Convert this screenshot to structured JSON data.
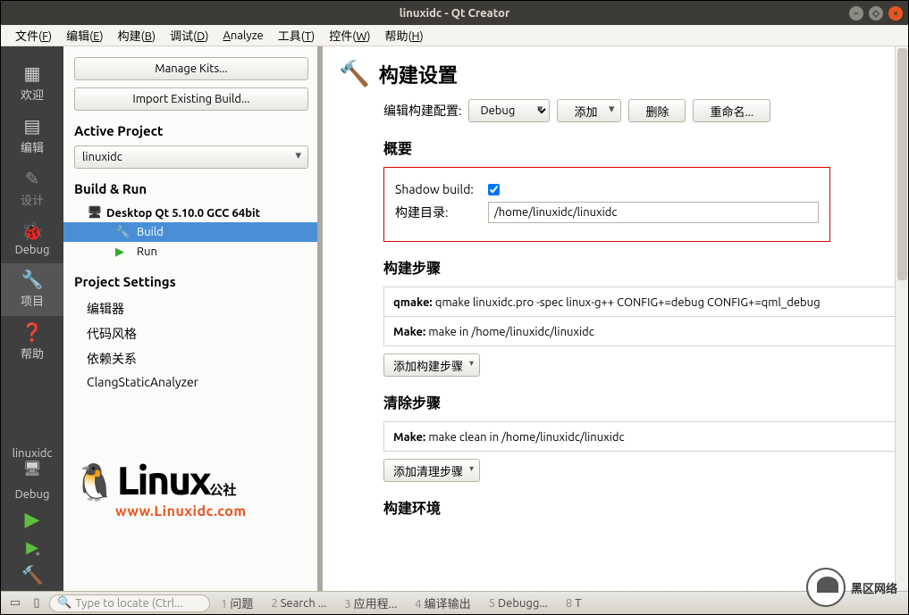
{
  "window": {
    "title": "linuxidc - Qt Creator"
  },
  "menu": {
    "file": "文件(F)",
    "edit": "编辑(E)",
    "build": "构建(B)",
    "debug": "调试(D)",
    "analyze": "Analyze",
    "tools": "工具(T)",
    "widgets": "控件(W)",
    "help": "帮助(H)"
  },
  "rail": {
    "welcome": "欢迎",
    "edit": "编辑",
    "design": "设计",
    "debug": "Debug",
    "project": "项目",
    "help": "帮助",
    "target": "linuxidc",
    "config": "Debug"
  },
  "leftpanel": {
    "manage_kits": "Manage Kits...",
    "import_build": "Import Existing Build...",
    "active_project": "Active Project",
    "project_selected": "linuxidc",
    "build_run": "Build & Run",
    "kit": "Desktop Qt 5.10.0 GCC 64bit",
    "build": "Build",
    "run": "Run",
    "project_settings": "Project Settings",
    "settings": {
      "editor": "编辑器",
      "codestyle": "代码风格",
      "deps": "依赖关系",
      "clang": "ClangStaticAnalyzer"
    }
  },
  "content": {
    "title": "构建设置",
    "config_label": "编辑构建配置:",
    "config_value": "Debug",
    "add": "添加",
    "delete": "删除",
    "rename": "重命名...",
    "summary": "概要",
    "shadow_label": "Shadow build:",
    "shadow_checked": true,
    "builddir_label": "构建目录:",
    "builddir_value": "/home/linuxidc/linuxidc",
    "build_steps": "构建步骤",
    "qmake_label": "qmake:",
    "qmake_cmd": "qmake linuxidc.pro -spec linux-g++ CONFIG+=debug CONFIG+=qml_debug",
    "make_label": "Make:",
    "make_cmd": "make in /home/linuxidc/linuxidc",
    "add_build_step": "添加构建步骤",
    "clean_steps": "清除步骤",
    "make_clean_cmd": "make clean in /home/linuxidc/linuxidc",
    "add_clean_step": "添加清理步骤",
    "build_env": "构建环境"
  },
  "statusbar": {
    "search_placeholder": "Type to locate (Ctrl...",
    "items": {
      "i1": "问题",
      "i2": "Search ...",
      "i3": "应用程...",
      "i4": "编译输出",
      "i5": "Debugg...",
      "i8": "T"
    }
  },
  "brand": "黑区网络",
  "watermark": {
    "main": "Linux",
    "sub": "公社",
    "url": "www.Linuxidc.com"
  }
}
